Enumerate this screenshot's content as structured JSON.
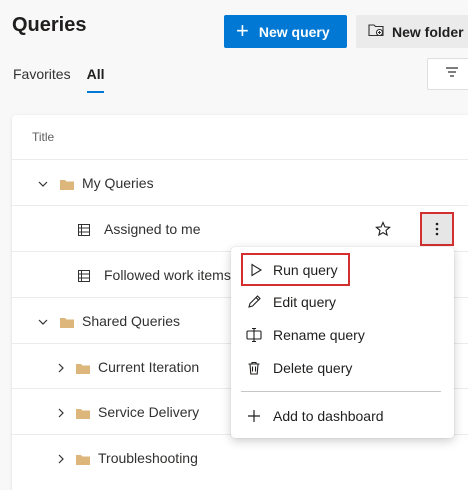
{
  "header": {
    "title": "Queries",
    "new_query_label": "New query",
    "new_folder_label": "New folder"
  },
  "tabs": [
    {
      "label": "Favorites",
      "active": false
    },
    {
      "label": "All",
      "active": true
    }
  ],
  "table": {
    "column_title": "Title",
    "rows": [
      {
        "label": "My Queries",
        "type": "folder",
        "expanded": true
      },
      {
        "label": "Assigned to me",
        "type": "query"
      },
      {
        "label": "Followed work items",
        "type": "query"
      },
      {
        "label": "Shared Queries",
        "type": "folder",
        "expanded": true
      },
      {
        "label": "Current Iteration",
        "type": "folder",
        "expanded": false
      },
      {
        "label": "Service Delivery",
        "type": "folder",
        "expanded": false
      },
      {
        "label": "Troubleshooting",
        "type": "folder",
        "expanded": false
      }
    ]
  },
  "context_menu": {
    "items": [
      {
        "label": "Run query",
        "icon": "play-icon"
      },
      {
        "label": "Edit query",
        "icon": "pencil-icon"
      },
      {
        "label": "Rename query",
        "icon": "rename-icon"
      },
      {
        "label": "Delete query",
        "icon": "trash-icon"
      },
      {
        "label": "Add to dashboard",
        "icon": "plus-icon"
      }
    ]
  },
  "colors": {
    "accent": "#0078d4",
    "highlight": "#d32f2f",
    "folder": "#dcb67a"
  }
}
